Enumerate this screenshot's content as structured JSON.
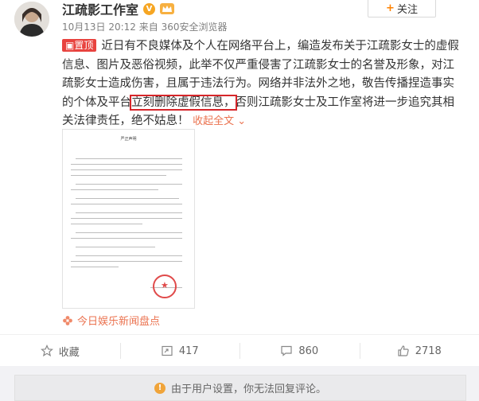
{
  "author": {
    "name": "江疏影工作室",
    "verified_glyph": "V",
    "member_glyph": "㊅",
    "avatar_icon": "avatar-photo"
  },
  "follow_button": {
    "plus": "+",
    "label": "关注"
  },
  "meta": {
    "time": "10月13日 20:12",
    "source": "来自 360安全浏览器"
  },
  "post": {
    "pin_label": "置顶",
    "text_before": "近日有不良媒体及个人在网络平台上，编造发布关于江疏影女士的虚假信息、图片及恶俗视频，此举不仅严重侵害了江疏影女士的名誉及形象，对江疏影女士造成伤害，且属于违法行为。网络并非法外之地，敬告传播捏造事实的个体及平台",
    "text_highlight": "立刻删除虚假信息，",
    "text_after": "否则江疏影女士及工作室将进一步追究其相关法律责任，绝不姑息！",
    "collapse_label": "收起全文",
    "collapse_icon": "chevron-up-icon"
  },
  "document_image": {
    "title": "严正声明"
  },
  "source_link": {
    "icon": "flower-icon",
    "label": "今日娱乐新闻盘点"
  },
  "actions": {
    "favorite": {
      "icon": "star-icon",
      "label": "收藏"
    },
    "repost": {
      "icon": "repost-icon",
      "count": "417"
    },
    "comment": {
      "icon": "comment-icon",
      "count": "860"
    },
    "like": {
      "icon": "thumb-up-icon",
      "count": "2718"
    }
  },
  "notice": {
    "icon": "warning-icon",
    "glyph": "!",
    "text": "由于用户设置，你无法回复评论。"
  },
  "colors": {
    "accent": "#eb7350",
    "pin_red": "#e8433f",
    "highlight_box": "#d6262a",
    "vip_orange": "#f6a623"
  }
}
